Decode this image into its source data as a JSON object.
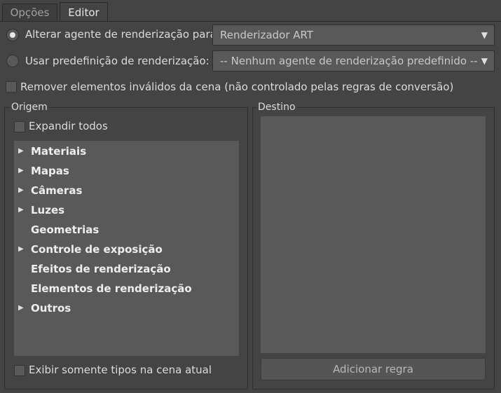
{
  "tabs": [
    {
      "label": "Opções",
      "active": false
    },
    {
      "label": "Editor",
      "active": true
    }
  ],
  "renderer_option": {
    "label": "Alterar agente de renderização para:",
    "selected": true,
    "dropdown_value": "Renderizador ART"
  },
  "preset_option": {
    "label": "Usar predefinição de renderização:",
    "selected": false,
    "dropdown_value": "-- Nenhum agente de renderização predefinido --"
  },
  "remove_invalid": {
    "label": "Remover elementos inválidos da cena (não controlado pelas regras de conversão)",
    "checked": false
  },
  "origin": {
    "title": "Origem",
    "expand_all_label": "Expandir todos",
    "items": [
      {
        "label": "Materiais",
        "expandable": true
      },
      {
        "label": "Mapas",
        "expandable": true
      },
      {
        "label": "Câmeras",
        "expandable": true
      },
      {
        "label": "Luzes",
        "expandable": true
      },
      {
        "label": "Geometrias",
        "expandable": false
      },
      {
        "label": "Controle de exposição",
        "expandable": true
      },
      {
        "label": "Efeitos de renderização",
        "expandable": false
      },
      {
        "label": "Elementos de renderização",
        "expandable": false
      },
      {
        "label": "Outros",
        "expandable": true
      }
    ],
    "show_only_label": "Exibir somente tipos na cena atual"
  },
  "destination": {
    "title": "Destino",
    "add_rule_label": "Adicionar regra"
  },
  "icons": {
    "dropdown": "chevron-down-icon",
    "expand": "triangle-right-icon"
  }
}
